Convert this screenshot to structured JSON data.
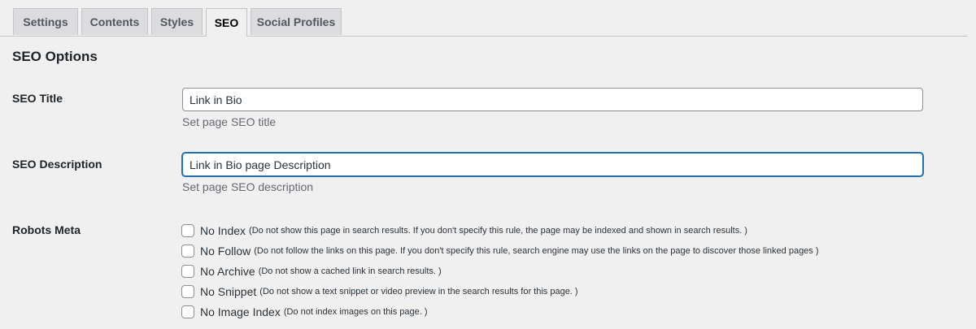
{
  "tabs": [
    {
      "label": "Settings"
    },
    {
      "label": "Contents"
    },
    {
      "label": "Styles"
    },
    {
      "label": "SEO"
    },
    {
      "label": "Social Profiles"
    }
  ],
  "active_tab": "SEO",
  "section": {
    "title": "SEO Options"
  },
  "seo_title": {
    "label": "SEO Title",
    "value": "Link in Bio",
    "description": "Set page SEO title"
  },
  "seo_description": {
    "label": "SEO Description",
    "value": "Link in Bio page Description",
    "description": "Set page SEO description"
  },
  "robots": {
    "label": "Robots Meta",
    "options": [
      {
        "label": "No Index",
        "hint": "(Do not show this page in search results. If you don't specify this rule, the page may be indexed and shown in search results. )",
        "checked": false
      },
      {
        "label": "No Follow",
        "hint": "(Do not follow the links on this page. If you don't specify this rule, search engine may use the links on the page to discover those linked pages )",
        "checked": false
      },
      {
        "label": "No Archive",
        "hint": "(Do not show a cached link in search results. )",
        "checked": false
      },
      {
        "label": "No Snippet",
        "hint": "(Do not show a text snippet or video preview in the search results for this page. )",
        "checked": false
      },
      {
        "label": "No Image Index",
        "hint": "(Do not index images on this page. )",
        "checked": false
      }
    ]
  },
  "colors": {
    "background": "#f0f0f1",
    "focus": "#2271b1",
    "inactive_tab": "#dcdcde"
  }
}
